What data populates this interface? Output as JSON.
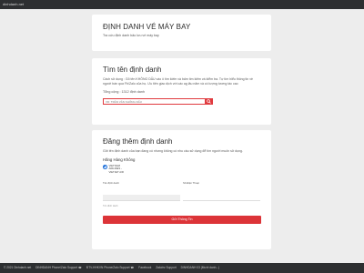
{
  "topbar": {
    "site": "dinhdanh.net"
  },
  "header": {
    "title": "ĐỊNH DANH VÉ MÁY BAY",
    "subtitle": "Tra cứu định danh bảo lưu vé máy bay"
  },
  "search": {
    "title": "Tìm tên định danh",
    "description": "Cách sử dụng : Gõ tên KHÔNG DẤU vào ô tìm kiếm và bấm tìm kiếm và kiểm tra. Tự tìm hiểu thông tin về người bán qua Fb/Zalo của họ. Ưu tiên giao dịch với các ag lâu năm và có lượng tương tác cao",
    "total": "Tổng cộng : 1312 định danh",
    "placeholder": "VD: TRẦN VĂN KHÔNG DẤU",
    "value": "",
    "button_icon": "search-icon"
  },
  "register": {
    "title": "Đăng thêm định danh",
    "description": "Gửi tên định danh của bạn đang có nhưng không có nhu cầu sử dụng để tìm người muốn sử dụng.",
    "airline_label": "Hãng Hàng Không",
    "airline_option": "VIETNAM AIRLINES - VIETJET AIR",
    "name_label": "Tên định danh",
    "name_hint": "Tên định danh",
    "phone_label": "Số Điện Thoại",
    "submit_label": "Gửi Thông Tin"
  },
  "footer": {
    "items": [
      "© 2021 Dinhdanh.net",
      "DINHDANH Phone/Zalo Support ☎",
      "ĐTV-HHKVN Phone/Zalo Support ☎",
      "Facebook",
      "Zalo/ez Support",
      "DINHDANH 03 (Mười danh...)"
    ]
  },
  "colors": {
    "accent": "#dc3438",
    "topbar": "#2d2f31",
    "radio": "#1e6fd9"
  }
}
